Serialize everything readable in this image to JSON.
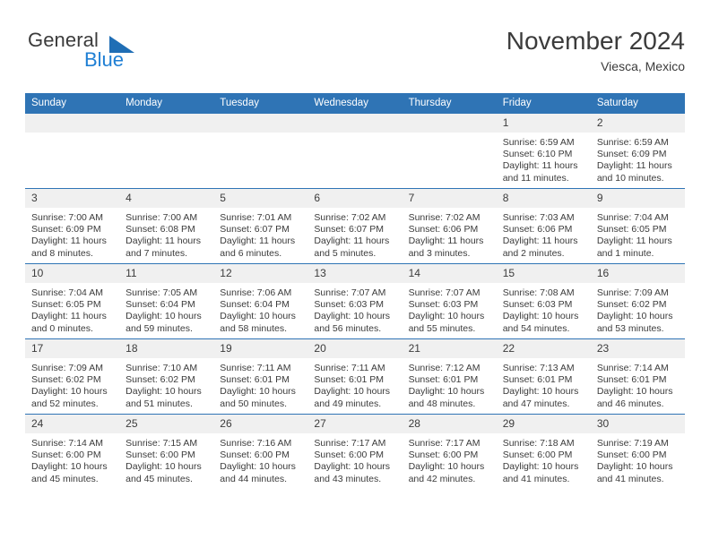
{
  "brand": {
    "name_part1": "General",
    "name_part2": "Blue",
    "triangle_color": "#1f6eb5",
    "blue_color": "#1f7fd4"
  },
  "header": {
    "title": "November 2024",
    "subtitle": "Viesca, Mexico"
  },
  "theme": {
    "header_row_bg": "#2f74b5",
    "daynum_bg": "#f0f0f0",
    "text_color": "#3b3b3b"
  },
  "weekday_headers": [
    "Sunday",
    "Monday",
    "Tuesday",
    "Wednesday",
    "Thursday",
    "Friday",
    "Saturday"
  ],
  "weeks": [
    [
      {
        "day": "",
        "empty": true
      },
      {
        "day": "",
        "empty": true
      },
      {
        "day": "",
        "empty": true
      },
      {
        "day": "",
        "empty": true
      },
      {
        "day": "",
        "empty": true
      },
      {
        "day": "1",
        "sunrise": "Sunrise: 6:59 AM",
        "sunset": "Sunset: 6:10 PM",
        "daylight": "Daylight: 11 hours and 11 minutes."
      },
      {
        "day": "2",
        "sunrise": "Sunrise: 6:59 AM",
        "sunset": "Sunset: 6:09 PM",
        "daylight": "Daylight: 11 hours and 10 minutes."
      }
    ],
    [
      {
        "day": "3",
        "sunrise": "Sunrise: 7:00 AM",
        "sunset": "Sunset: 6:09 PM",
        "daylight": "Daylight: 11 hours and 8 minutes."
      },
      {
        "day": "4",
        "sunrise": "Sunrise: 7:00 AM",
        "sunset": "Sunset: 6:08 PM",
        "daylight": "Daylight: 11 hours and 7 minutes."
      },
      {
        "day": "5",
        "sunrise": "Sunrise: 7:01 AM",
        "sunset": "Sunset: 6:07 PM",
        "daylight": "Daylight: 11 hours and 6 minutes."
      },
      {
        "day": "6",
        "sunrise": "Sunrise: 7:02 AM",
        "sunset": "Sunset: 6:07 PM",
        "daylight": "Daylight: 11 hours and 5 minutes."
      },
      {
        "day": "7",
        "sunrise": "Sunrise: 7:02 AM",
        "sunset": "Sunset: 6:06 PM",
        "daylight": "Daylight: 11 hours and 3 minutes."
      },
      {
        "day": "8",
        "sunrise": "Sunrise: 7:03 AM",
        "sunset": "Sunset: 6:06 PM",
        "daylight": "Daylight: 11 hours and 2 minutes."
      },
      {
        "day": "9",
        "sunrise": "Sunrise: 7:04 AM",
        "sunset": "Sunset: 6:05 PM",
        "daylight": "Daylight: 11 hours and 1 minute."
      }
    ],
    [
      {
        "day": "10",
        "sunrise": "Sunrise: 7:04 AM",
        "sunset": "Sunset: 6:05 PM",
        "daylight": "Daylight: 11 hours and 0 minutes."
      },
      {
        "day": "11",
        "sunrise": "Sunrise: 7:05 AM",
        "sunset": "Sunset: 6:04 PM",
        "daylight": "Daylight: 10 hours and 59 minutes."
      },
      {
        "day": "12",
        "sunrise": "Sunrise: 7:06 AM",
        "sunset": "Sunset: 6:04 PM",
        "daylight": "Daylight: 10 hours and 58 minutes."
      },
      {
        "day": "13",
        "sunrise": "Sunrise: 7:07 AM",
        "sunset": "Sunset: 6:03 PM",
        "daylight": "Daylight: 10 hours and 56 minutes."
      },
      {
        "day": "14",
        "sunrise": "Sunrise: 7:07 AM",
        "sunset": "Sunset: 6:03 PM",
        "daylight": "Daylight: 10 hours and 55 minutes."
      },
      {
        "day": "15",
        "sunrise": "Sunrise: 7:08 AM",
        "sunset": "Sunset: 6:03 PM",
        "daylight": "Daylight: 10 hours and 54 minutes."
      },
      {
        "day": "16",
        "sunrise": "Sunrise: 7:09 AM",
        "sunset": "Sunset: 6:02 PM",
        "daylight": "Daylight: 10 hours and 53 minutes."
      }
    ],
    [
      {
        "day": "17",
        "sunrise": "Sunrise: 7:09 AM",
        "sunset": "Sunset: 6:02 PM",
        "daylight": "Daylight: 10 hours and 52 minutes."
      },
      {
        "day": "18",
        "sunrise": "Sunrise: 7:10 AM",
        "sunset": "Sunset: 6:02 PM",
        "daylight": "Daylight: 10 hours and 51 minutes."
      },
      {
        "day": "19",
        "sunrise": "Sunrise: 7:11 AM",
        "sunset": "Sunset: 6:01 PM",
        "daylight": "Daylight: 10 hours and 50 minutes."
      },
      {
        "day": "20",
        "sunrise": "Sunrise: 7:11 AM",
        "sunset": "Sunset: 6:01 PM",
        "daylight": "Daylight: 10 hours and 49 minutes."
      },
      {
        "day": "21",
        "sunrise": "Sunrise: 7:12 AM",
        "sunset": "Sunset: 6:01 PM",
        "daylight": "Daylight: 10 hours and 48 minutes."
      },
      {
        "day": "22",
        "sunrise": "Sunrise: 7:13 AM",
        "sunset": "Sunset: 6:01 PM",
        "daylight": "Daylight: 10 hours and 47 minutes."
      },
      {
        "day": "23",
        "sunrise": "Sunrise: 7:14 AM",
        "sunset": "Sunset: 6:01 PM",
        "daylight": "Daylight: 10 hours and 46 minutes."
      }
    ],
    [
      {
        "day": "24",
        "sunrise": "Sunrise: 7:14 AM",
        "sunset": "Sunset: 6:00 PM",
        "daylight": "Daylight: 10 hours and 45 minutes."
      },
      {
        "day": "25",
        "sunrise": "Sunrise: 7:15 AM",
        "sunset": "Sunset: 6:00 PM",
        "daylight": "Daylight: 10 hours and 45 minutes."
      },
      {
        "day": "26",
        "sunrise": "Sunrise: 7:16 AM",
        "sunset": "Sunset: 6:00 PM",
        "daylight": "Daylight: 10 hours and 44 minutes."
      },
      {
        "day": "27",
        "sunrise": "Sunrise: 7:17 AM",
        "sunset": "Sunset: 6:00 PM",
        "daylight": "Daylight: 10 hours and 43 minutes."
      },
      {
        "day": "28",
        "sunrise": "Sunrise: 7:17 AM",
        "sunset": "Sunset: 6:00 PM",
        "daylight": "Daylight: 10 hours and 42 minutes."
      },
      {
        "day": "29",
        "sunrise": "Sunrise: 7:18 AM",
        "sunset": "Sunset: 6:00 PM",
        "daylight": "Daylight: 10 hours and 41 minutes."
      },
      {
        "day": "30",
        "sunrise": "Sunrise: 7:19 AM",
        "sunset": "Sunset: 6:00 PM",
        "daylight": "Daylight: 10 hours and 41 minutes."
      }
    ]
  ]
}
